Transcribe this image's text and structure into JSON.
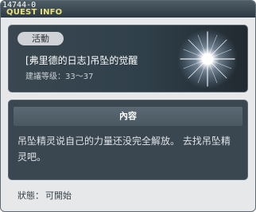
{
  "window": {
    "id": "14744-0",
    "title": "QUEST INFO"
  },
  "quest": {
    "badge": "活動",
    "title": "[弗里德的日志]吊坠的觉醒",
    "level": "建議等级：33～37",
    "icon": "sparkle-glow-icon"
  },
  "description": {
    "header": "內容",
    "line1": "吊坠精灵说自己的力量还没完全解放。 去找吊坠精",
    "line2": "灵吧。"
  },
  "status": {
    "label": "狀態：",
    "value": "可開始"
  },
  "colors": {
    "title_text": "#e9e27a",
    "titlebar": "#3a4750",
    "panel": "#3a4650"
  }
}
